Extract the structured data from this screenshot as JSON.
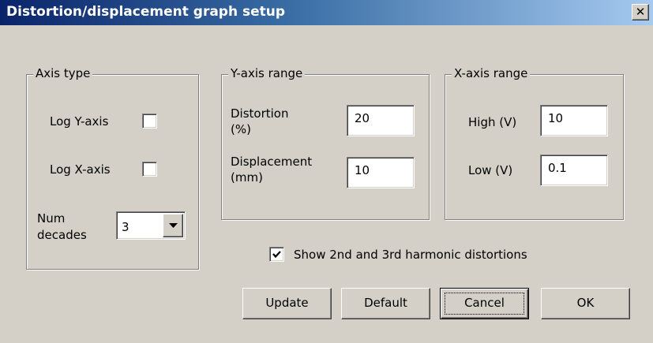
{
  "window": {
    "title": "Distortion/displacement graph setup",
    "close_glyph": "✕"
  },
  "axis_type": {
    "legend": "Axis type",
    "log_y_label": "Log Y-axis",
    "log_y_checked": false,
    "log_x_label": "Log X-axis",
    "log_x_checked": false,
    "num_decades_label_line1": "Num",
    "num_decades_label_line2": "decades",
    "num_decades_value": "3"
  },
  "y_axis_range": {
    "legend": "Y-axis range",
    "distortion_label_line1": "Distortion",
    "distortion_label_line2": "(%)",
    "distortion_value": "20",
    "displacement_label_line1": "Displacement",
    "displacement_label_line2": "(mm)",
    "displacement_value": "10"
  },
  "x_axis_range": {
    "legend": "X-axis range",
    "high_label": "High (V)",
    "high_value": "10",
    "low_label": "Low (V)",
    "low_value": "0.1"
  },
  "show_harmonics": {
    "label": "Show 2nd and 3rd harmonic distortions",
    "checked": true
  },
  "buttons": {
    "update": "Update",
    "default": "Default",
    "cancel": "Cancel",
    "ok": "OK"
  },
  "colors": {
    "titlebar_start": "#0a246a",
    "titlebar_end": "#a6caf0",
    "dialog_face": "#d4d0c8"
  }
}
